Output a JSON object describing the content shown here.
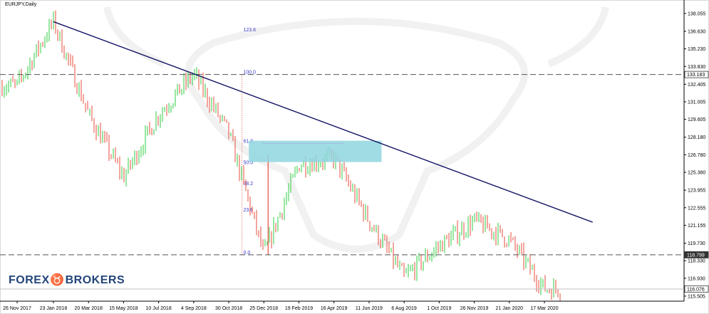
{
  "window": {
    "symbol_label": "EURJPY,Daily"
  },
  "brand": {
    "left": "FOREX",
    "right": "BROKERS"
  },
  "chart_data": {
    "type": "line",
    "symbol": "EURJPY",
    "timeframe": "Daily",
    "ylim": [
      115.1,
      138.9
    ],
    "y_ticks": [
      138.055,
      136.63,
      135.23,
      133.83,
      132.405,
      131.005,
      129.605,
      128.18,
      126.78,
      125.38,
      123.955,
      122.555,
      121.155,
      119.73,
      118.33,
      116.93,
      115.505
    ],
    "x_ticks": [
      "26 Nov 2017",
      "23 Jan 2018",
      "20 Mar 2018",
      "15 May 2018",
      "10 Jul 2018",
      "4 Sep 2018",
      "30 Oct 2018",
      "25 Dec 2018",
      "19 Feb 2019",
      "16 Apr 2019",
      "11 Jun 2019",
      "6 Aug 2019",
      "1 Oct 2019",
      "26 Nov 2019",
      "21 Jan 2020",
      "17 Mar 2020"
    ],
    "price_tags": [
      {
        "value": 133.183,
        "label": "133.183"
      },
      {
        "value": 118.799,
        "label": "118.799"
      },
      {
        "value": 116.076,
        "label": "116.076"
      }
    ],
    "fibonacci": {
      "high": 133.183,
      "low": 118.799,
      "levels": [
        {
          "ratio": 123.6,
          "label": "123.6"
        },
        {
          "ratio": 100.0,
          "label": "100.0"
        },
        {
          "ratio": 61.8,
          "label": "61.8"
        },
        {
          "ratio": 50.0,
          "label": "50.0"
        },
        {
          "ratio": 38.2,
          "label": "38.2"
        },
        {
          "ratio": 23.6,
          "label": "23.6"
        },
        {
          "ratio": 0.0,
          "label": "0.0"
        }
      ]
    },
    "key_points": [
      {
        "x": "26 Nov 2017",
        "y": 132.3
      },
      {
        "x": "23 Jan 2018",
        "y": 137.4
      },
      {
        "x": "20 Mar 2018",
        "y": 130.0
      },
      {
        "x": "15 May 2018",
        "y": 125.0
      },
      {
        "x": "10 Jul 2018",
        "y": 130.0
      },
      {
        "x": "4 Sep 2018",
        "y": 133.2
      },
      {
        "x": "30 Oct 2018",
        "y": 128.5
      },
      {
        "x": "25 Dec 2018",
        "y": 118.8
      },
      {
        "x": "19 Feb 2019",
        "y": 126.0
      },
      {
        "x": "16 Apr 2019",
        "y": 126.5
      },
      {
        "x": "11 Jun 2019",
        "y": 121.5
      },
      {
        "x": "6 Aug 2019",
        "y": 117.0
      },
      {
        "x": "1 Oct 2019",
        "y": 119.5
      },
      {
        "x": "26 Nov 2019",
        "y": 121.5
      },
      {
        "x": "21 Jan 2020",
        "y": 120.0
      },
      {
        "x": "17 Mar 2020",
        "y": 116.1
      }
    ],
    "trendline": {
      "from": {
        "x": "23 Jan 2018",
        "y": 137.4
      },
      "to": {
        "x": "2 Jun 2020",
        "y": 121.4
      }
    },
    "zone": {
      "x_from": "1 Dec 2018",
      "x_to": "1 Jul 2019",
      "y_from": 126.2,
      "y_to": 127.9
    },
    "colors": {
      "up": "#2ecc40",
      "down": "#e74c3c",
      "trendline": "#141466",
      "zone": "#8fd6df",
      "fib": "#3a3ac8",
      "fib_marker": "#ff55cc"
    }
  }
}
